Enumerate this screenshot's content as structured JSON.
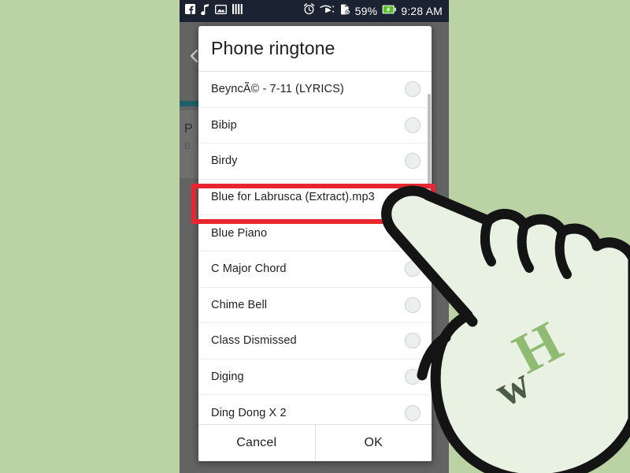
{
  "background": {
    "color": "#bad2a4"
  },
  "phone": {
    "statusbar": {
      "background": "#1b2332",
      "left_icons": [
        {
          "name": "facebook-icon",
          "label": "f"
        },
        {
          "name": "music-note-icon",
          "label": "♪"
        },
        {
          "name": "gallery-image-icon",
          "label": "image"
        },
        {
          "name": "equalizer-bars-icon",
          "label": "bars"
        }
      ],
      "right_icons": [
        {
          "name": "alarm-clock-icon",
          "label": "alarm"
        },
        {
          "name": "wifi-icon",
          "label": "wifi"
        },
        {
          "name": "sd-card-removed-icon",
          "label": "sd-card"
        }
      ],
      "battery_percent": "59%",
      "battery_state": "charging",
      "clock": "9:28 AM"
    },
    "behind": {
      "back_label": "‹",
      "accent_color": "#1d5f6b",
      "text_line_1": "P",
      "text_line_2": "B"
    }
  },
  "dialog": {
    "title": "Phone ringtone",
    "items": [
      {
        "label": "BeyncÃ© - 7-11 (LYRICS)",
        "selected": false
      },
      {
        "label": "Bibip",
        "selected": false
      },
      {
        "label": "Birdy",
        "selected": false
      },
      {
        "label": "Blue for Labrusca (Extract).mp3",
        "selected": true
      },
      {
        "label": "Blue Piano",
        "selected": false
      },
      {
        "label": "C Major Chord",
        "selected": false
      },
      {
        "label": "Chime Bell",
        "selected": false
      },
      {
        "label": "Class Dismissed",
        "selected": false
      },
      {
        "label": "Diging",
        "selected": false
      },
      {
        "label": "Ding Dong X 2",
        "selected": false
      }
    ],
    "buttons": {
      "cancel": "Cancel",
      "ok": "OK"
    },
    "selected_accent": "#5bb4d6"
  },
  "annotation": {
    "highlight_color": "#e8262f",
    "highlight_target": "Blue for Labrusca (Extract).mp3"
  },
  "watermark": {
    "text_w": "w",
    "text_h": "H",
    "color_w": "#4a5c45",
    "color_h": "#8fbc72"
  }
}
